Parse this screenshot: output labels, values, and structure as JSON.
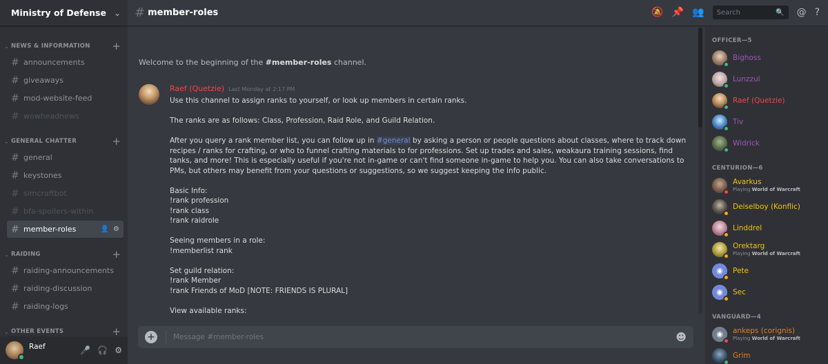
{
  "server": {
    "name": "Ministry of Defense"
  },
  "sidebar": {
    "categories": [
      {
        "name": "NEWS & INFORMATION",
        "channels": [
          "announcements",
          "giveaways",
          "mod-website-feed",
          "wowheadnews"
        ]
      },
      {
        "name": "GENERAL CHATTER",
        "channels": [
          "general",
          "keystones",
          "simcraftbot",
          "bfa-spoilers-within",
          "member-roles"
        ]
      },
      {
        "name": "RAIDING",
        "channels": [
          "raiding-announcements",
          "raiding-discussion",
          "raiding-logs"
        ]
      },
      {
        "name": "OTHER EVENTS",
        "channels": []
      }
    ]
  },
  "user_panel": {
    "username": "Raef"
  },
  "header": {
    "channel": "member-roles",
    "search_placeholder": "Search"
  },
  "welcome": {
    "prefix": "Welcome to the beginning of the ",
    "channel": "#member-roles",
    "suffix": " channel."
  },
  "message": {
    "author": "Raef (Quetzie)",
    "timestamp": "Last Monday at 2:17 PM",
    "lines": [
      "Use this channel to assign ranks to yourself, or look up members in certain ranks.",
      "",
      "The ranks are as follows: Class, Profession, Raid Role, and Guild Relation.",
      "",
      "After you query a rank member list, you can follow up in ",
      "#general",
      " by asking a person or people questions about classes, where to track down recipes / ranks for crafting, or who to funnel crafting materials to for professions. Set up trades and sales, weakaura training sessions, find tanks, and more! This is especially useful if you're not in-game or can't find someone in-game to help you. You can also take conversations to PMs, but others may benefit from your questions or suggestions, so we suggest keeping the info public.",
      "",
      "Basic Info:",
      "!rank profession",
      "!rank class",
      "!rank raidrole",
      "",
      "Seeing members in a role:",
      "!memberlist rank",
      "",
      "Set guild relation:",
      "!rank Member",
      "!rank Friends of MoD [NOTE: FRIENDS IS PLURAL]",
      "",
      "View available ranks:"
    ]
  },
  "composer": {
    "placeholder": "Message #member-roles"
  },
  "members": {
    "groups": [
      {
        "role": "OFFICER—5",
        "items": [
          {
            "name": "Bighoss",
            "color": "#9b59b6",
            "status": "#43b581"
          },
          {
            "name": "Lunzzul",
            "color": "#9b59b6",
            "status": "#43b581"
          },
          {
            "name": "Raef (Quetzie)",
            "color": "#f04747",
            "status": "#43b581"
          },
          {
            "name": "Tiv",
            "color": "#9b59b6",
            "status": "#43b581"
          },
          {
            "name": "Widrick",
            "color": "#9b59b6",
            "status": "#43b581"
          }
        ]
      },
      {
        "role": "CENTURION—6",
        "items": [
          {
            "name": "Avarkus",
            "color": "#f1c40f",
            "status": "#f04747",
            "activity": "World of Warcraft"
          },
          {
            "name": "Deiselboy (Konflic)",
            "color": "#f1c40f",
            "status": "#faa61a"
          },
          {
            "name": "Linddrel",
            "color": "#f1c40f",
            "status": "#faa61a"
          },
          {
            "name": "Orektarg",
            "color": "#f1c40f",
            "status": "#faa61a",
            "activity": "World of Warcraft"
          },
          {
            "name": "Pete",
            "color": "#f1c40f",
            "status": "#faa61a"
          },
          {
            "name": "Sec",
            "color": "#f1c40f",
            "status": "#faa61a"
          }
        ]
      },
      {
        "role": "VANGUARD—4",
        "items": [
          {
            "name": "ankeps (corignis)",
            "color": "#e67e22",
            "status": "#f04747",
            "activity": "World of Warcraft"
          },
          {
            "name": "Grim",
            "color": "#e67e22",
            "status": "#43b581"
          }
        ]
      }
    ],
    "playing_label": "Playing "
  }
}
